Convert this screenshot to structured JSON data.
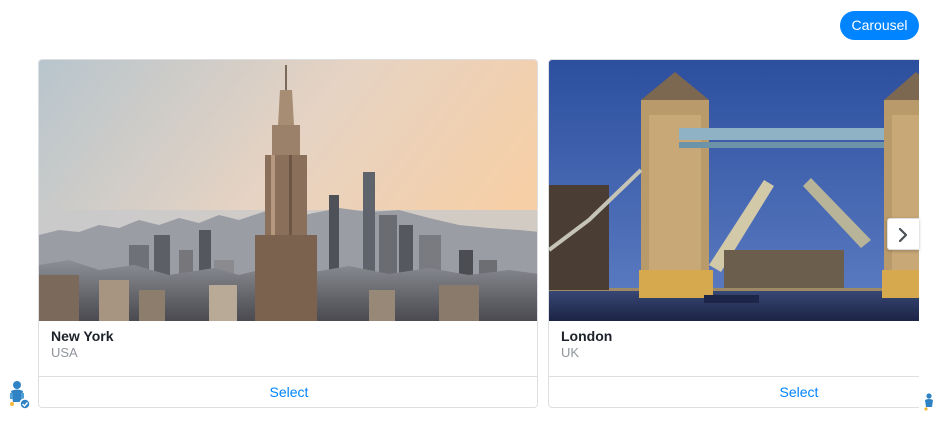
{
  "header": {
    "pill_label": "Carousel"
  },
  "carousel": {
    "cards": [
      {
        "title": "New York",
        "subtitle": "USA",
        "button_label": "Select",
        "image_icon": "new-york-skyline"
      },
      {
        "title": "London",
        "subtitle": "UK",
        "button_label": "Select",
        "image_icon": "tower-bridge"
      }
    ],
    "next_icon": "chevron-right-icon"
  },
  "colors": {
    "accent": "#0084ff",
    "title": "#1d2129",
    "subtitle": "#90949c",
    "border": "#dddfe2"
  },
  "avatars": {
    "left_icon": "bot-avatar",
    "right_icon": "bot-avatar"
  }
}
